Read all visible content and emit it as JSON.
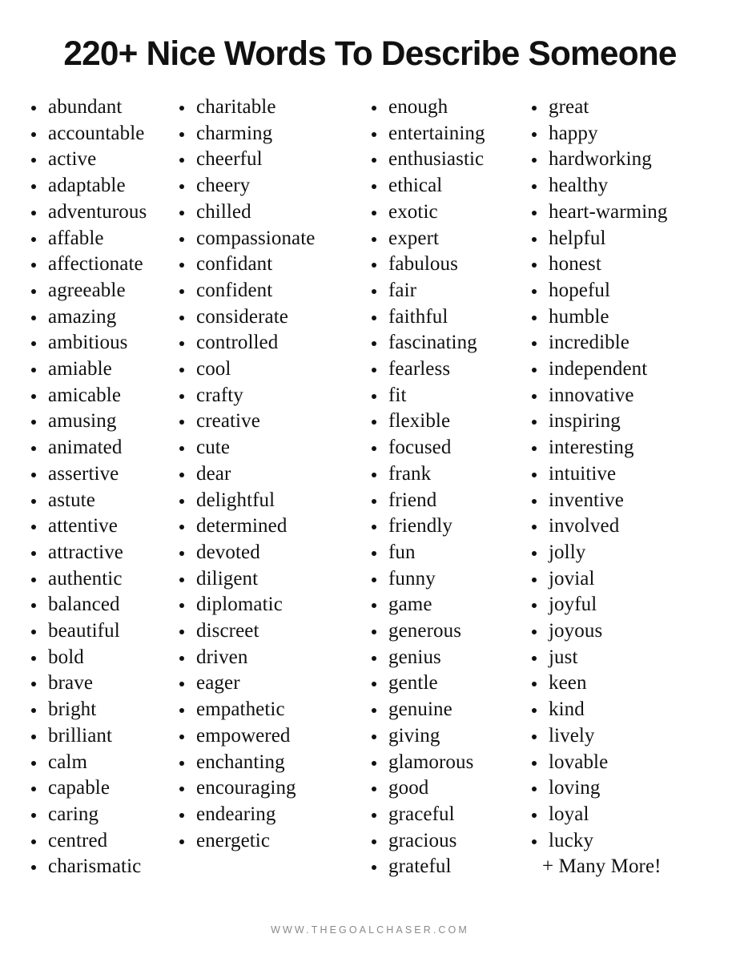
{
  "page": {
    "title": "220+ Nice Words To Describe Someone",
    "background_color": "#ffffff",
    "text_color": "#111111",
    "bullet_color": "#111111"
  },
  "columns": [
    {
      "id": "column-1",
      "words": [
        "abundant",
        "accountable",
        "active",
        "adaptable",
        "adventurous",
        "affable",
        "affectionate",
        "agreeable",
        "amazing",
        "ambitious",
        "amiable",
        "amicable",
        "amusing",
        "animated",
        "assertive",
        "astute",
        "attentive",
        "attractive",
        "authentic",
        "balanced",
        "beautiful",
        "bold",
        "brave",
        "bright",
        "brilliant",
        "calm",
        "capable",
        "caring",
        "centred",
        "charismatic"
      ]
    },
    {
      "id": "column-2",
      "words": [
        "charitable",
        "charming",
        "cheerful",
        "cheery",
        "chilled",
        "compassionate",
        "confidant",
        "confident",
        "considerate",
        "controlled",
        "cool",
        "crafty",
        "creative",
        "cute",
        "dear",
        "delightful",
        "determined",
        "devoted",
        "diligent",
        "diplomatic",
        "discreet",
        "driven",
        "eager",
        "empathetic",
        "empowered",
        "enchanting",
        "encouraging",
        "endearing",
        "energetic"
      ]
    },
    {
      "id": "column-3",
      "words": [
        "enough",
        "entertaining",
        "enthusiastic",
        "ethical",
        "exotic",
        "expert",
        "fabulous",
        "fair",
        "faithful",
        "fascinating",
        "fearless",
        "fit",
        "flexible",
        "focused",
        "frank",
        "friend",
        "friendly",
        "fun",
        "funny",
        "game",
        "generous",
        "genius",
        "gentle",
        "genuine",
        "giving",
        "glamorous",
        "good",
        "graceful",
        "gracious",
        "grateful"
      ]
    },
    {
      "id": "column-4",
      "words": [
        "great",
        "happy",
        "hardworking",
        "healthy",
        "heart-warming",
        "helpful",
        "honest",
        "hopeful",
        "humble",
        "incredible",
        "independent",
        "innovative",
        "inspiring",
        "interesting",
        "intuitive",
        "inventive",
        "involved",
        "jolly",
        "jovial",
        "joyful",
        "joyous",
        "just",
        "keen",
        "kind",
        "lively",
        "lovable",
        "loving",
        "loyal",
        "lucky"
      ],
      "tagline": "+ Many More!"
    }
  ],
  "footer": {
    "url": "WWW.THEGOALCHASER.COM",
    "color": "#8a8a8a"
  }
}
